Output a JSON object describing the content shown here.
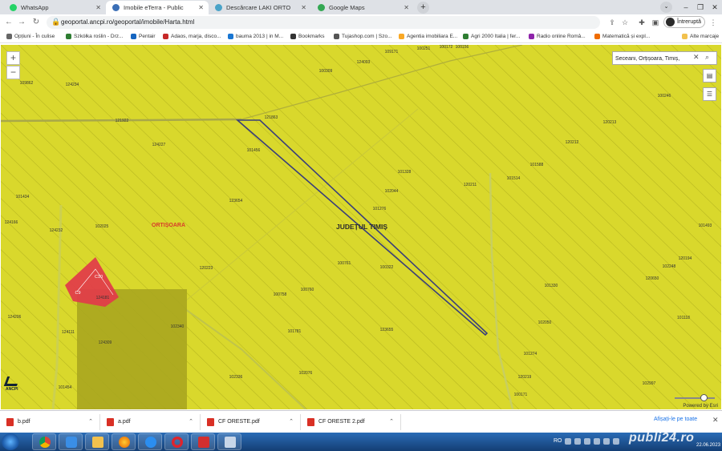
{
  "tabs": [
    {
      "label": "WhatsApp",
      "color": "#25d366",
      "active": false
    },
    {
      "label": "Imobile eTerra - Public",
      "color": "#3b6fb6",
      "active": true
    },
    {
      "label": "Descărcare LAKI ORTO",
      "color": "#4aa3c8",
      "active": false
    },
    {
      "label": "Google Maps",
      "color": "#34a853",
      "active": false
    }
  ],
  "address": {
    "url": "geoportal.ancpi.ro/geoportal/imobile/Harta.html"
  },
  "profile": {
    "label": "Întreruptă"
  },
  "bookmarks": [
    {
      "label": "Opțiuni - În culise",
      "color": "#666"
    },
    {
      "label": "Szkółka roślin - Drz...",
      "color": "#2e7d32"
    },
    {
      "label": "Pentair",
      "color": "#1565c0"
    },
    {
      "label": "Adaos, marja, disco...",
      "color": "#c62828"
    },
    {
      "label": "bauma 2013 | in M...",
      "color": "#1976d2"
    },
    {
      "label": "Bookmarks",
      "color": "#333"
    },
    {
      "label": "Tujashop.com | Szo...",
      "color": "#555"
    },
    {
      "label": "Agentia imobiliara E...",
      "color": "#f9a825"
    },
    {
      "label": "Agri 2000 Italia | fer...",
      "color": "#2e7d32"
    },
    {
      "label": "Radio online Româ...",
      "color": "#8e24aa"
    },
    {
      "label": "Matematică și expl...",
      "color": "#ef6c00"
    }
  ],
  "bookmarks_more": "Alte marcaje",
  "map": {
    "search_value": "Seceani, Orțișoara, Timiș,",
    "place_label": "ORTIȘOARA",
    "county_label": "JUDEȚUL TIMIȘ",
    "zone_labels": [
      "C10",
      "C9"
    ],
    "powered_by": "Powered by Esri",
    "logo_text": "ANCPI",
    "parcel_labels": [
      "109171",
      "100251",
      "100172",
      "100156",
      "124093",
      "100309",
      "109862",
      "124234",
      "121922",
      "121863",
      "124227",
      "101456",
      "101328",
      "120213",
      "100246",
      "120212",
      "101588",
      "101514",
      "120211",
      "102044",
      "101434",
      "123654",
      "101276",
      "124166",
      "124232",
      "102025",
      "101493",
      "100761",
      "100322",
      "120194",
      "102248",
      "120223",
      "100758",
      "100760",
      "124181",
      "101330",
      "120650",
      "124206",
      "102340",
      "124111",
      "101781",
      "123655",
      "102050",
      "101118",
      "124309",
      "101274",
      "102336",
      "102076",
      "120219",
      "102997",
      "101454",
      "100171"
    ]
  },
  "downloads": [
    {
      "name": "b.pdf"
    },
    {
      "name": "a.pdf"
    },
    {
      "name": "CF ORESTE.pdf"
    },
    {
      "name": "CF ORESTE 2.pdf"
    }
  ],
  "show_all": "Afișați-le pe toate",
  "taskbar": {
    "lang": "RO",
    "date": "22.06.2023",
    "watermark": "publi24.ro"
  }
}
